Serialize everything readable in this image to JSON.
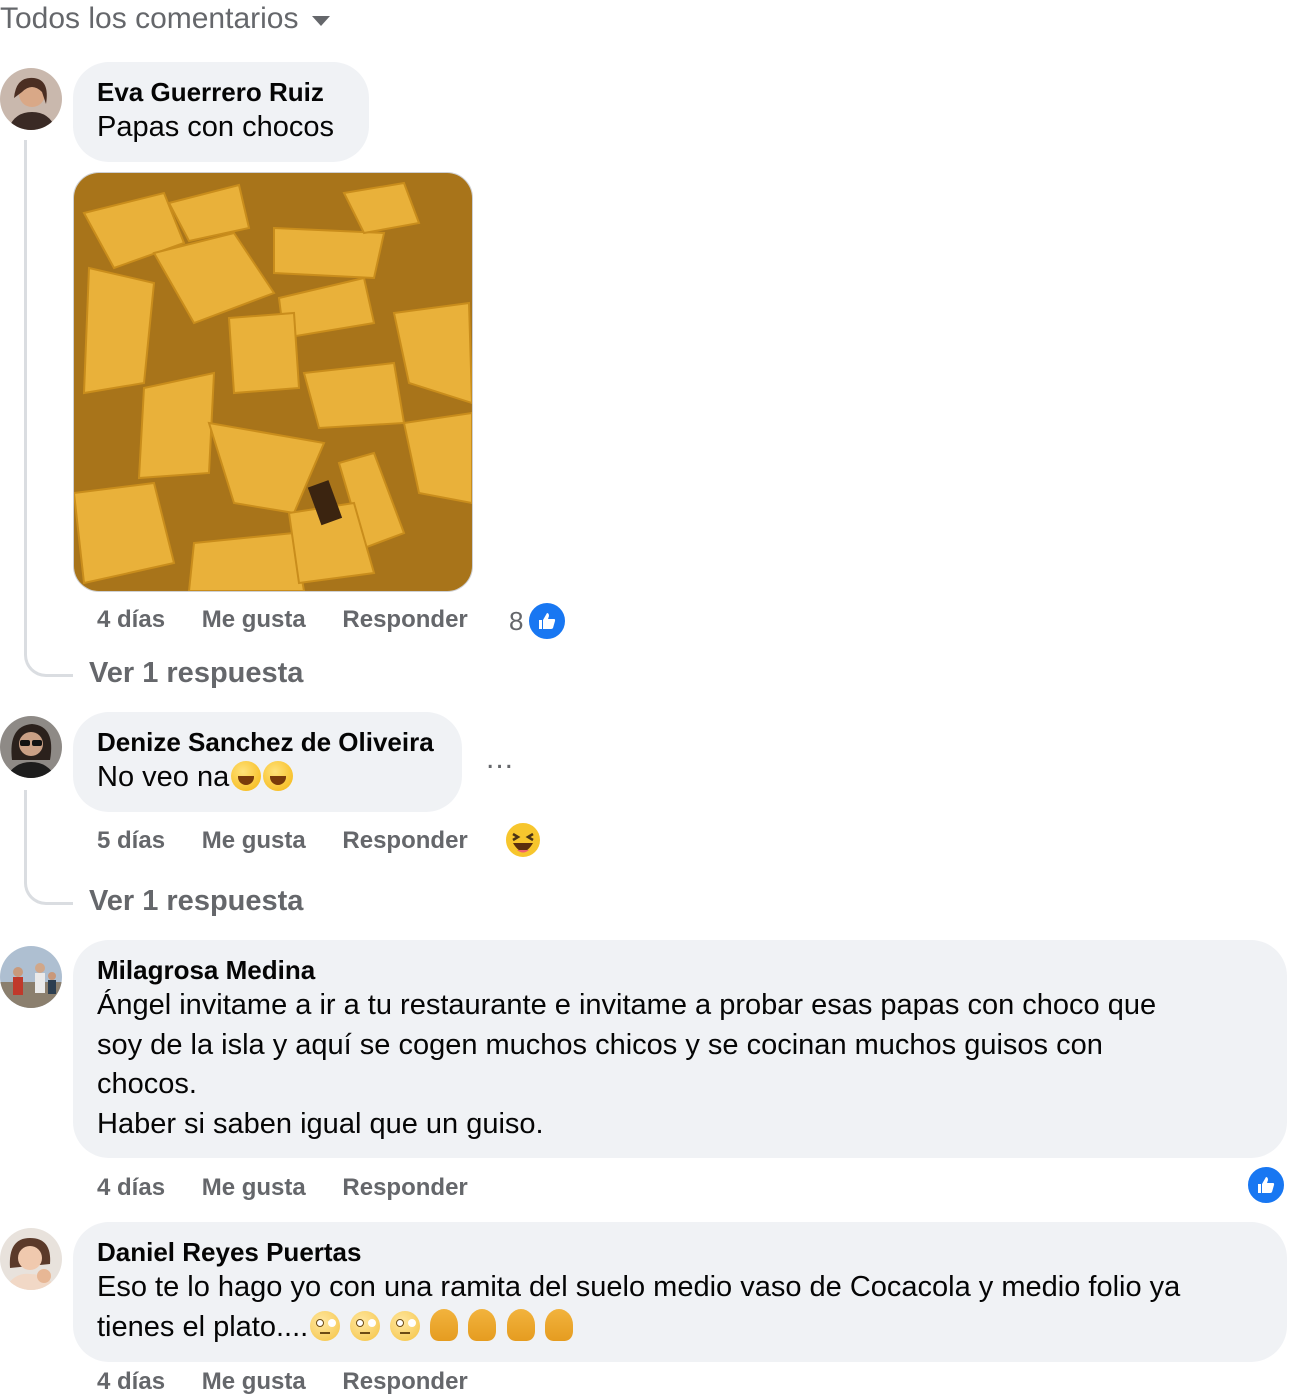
{
  "header": {
    "filter_label": "Todos los comentarios"
  },
  "comments": [
    {
      "author": "Eva Guerrero Ruiz",
      "text": "Papas con chocos",
      "time": "4 días",
      "like_label": "Me gusta",
      "reply_label": "Responder",
      "reaction_count": "8",
      "reaction_icon": "like-icon",
      "replies_label": "Ver 1 respuesta",
      "has_image": true
    },
    {
      "author": "Denize Sanchez de Oliveira",
      "text": "No veo na",
      "emojis": [
        "rolling-laughing-emoji",
        "rolling-laughing-emoji"
      ],
      "time": "5 días",
      "like_label": "Me gusta",
      "reply_label": "Responder",
      "reaction_icon": "haha-icon",
      "replies_label": "Ver 1 respuesta",
      "more_label": "..."
    },
    {
      "author": "Milagrosa Medina",
      "text": "Ángel invitame a ir a tu restaurante e invitame a probar esas papas con choco que\nsoy de la isla y aquí se cogen muchos chicos y se cocinan muchos guisos con\nchocos.\nHaber si saben igual que un guiso.",
      "time": "4 días",
      "like_label": "Me gusta",
      "reply_label": "Responder",
      "reaction_icon": "like-icon"
    },
    {
      "author": "Daniel Reyes Puertas",
      "text_line1": "Eso te lo hago yo con una ramita del suelo medio vaso de Cocacola y medio folio ya",
      "text_line2": "tienes el plato....",
      "emojis": [
        "eye-roll-emoji",
        "eye-roll-emoji",
        "eye-roll-emoji",
        "facepalm-emoji",
        "facepalm-emoji",
        "facepalm-emoji",
        "facepalm-emoji"
      ],
      "time": "4 días",
      "like_label": "Me gusta",
      "reply_label": "Responder"
    }
  ],
  "colors": {
    "accent": "#1877f2",
    "bubble": "#f0f2f5",
    "muted_text": "#65676b"
  }
}
